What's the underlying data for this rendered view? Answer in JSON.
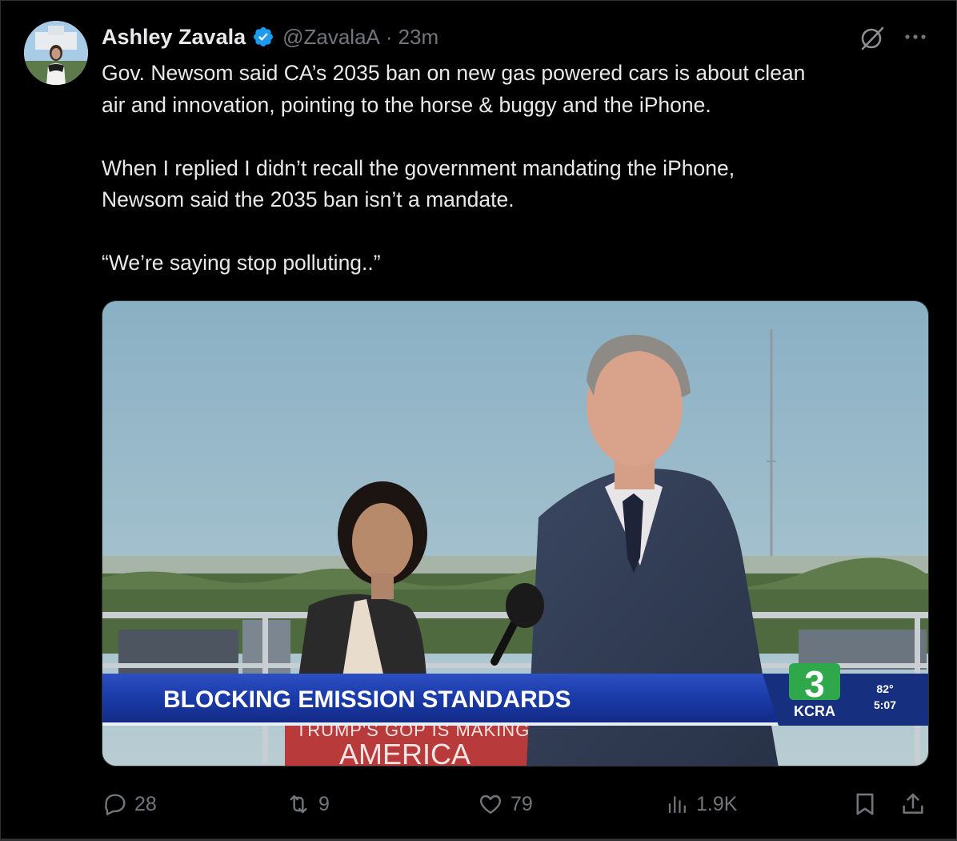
{
  "tweet": {
    "author_name": "Ashley Zavala",
    "handle": "@ZavalaA",
    "separator": "·",
    "time": "23m",
    "text": "Gov. Newsom said CA’s 2035 ban on new gas powered cars is about clean\nair and innovation, pointing to the horse & buggy and the iPhone.\n\nWhen I replied I didn’t recall the government mandating the iPhone,\nNewsom said the 2035 ban isn’t a mandate.\n\n“We’re saying stop polluting..”"
  },
  "media": {
    "chyron": "BLOCKING EMISSION STANDARDS",
    "station_number": "3",
    "station_name": "KCRA",
    "temperature": "82°",
    "clock": "5:07",
    "podium_line1": "TRUMP'S GOP IS MAKING",
    "podium_line2": "AMERICA"
  },
  "actions": {
    "replies": "28",
    "reposts": "9",
    "likes": "79",
    "views": "1.9K"
  },
  "colors": {
    "background": "#000000",
    "text": "#e7e9ea",
    "secondary": "#71767b",
    "verified": "#1d9bf0",
    "chyron_blue": "#1a3aa8"
  }
}
